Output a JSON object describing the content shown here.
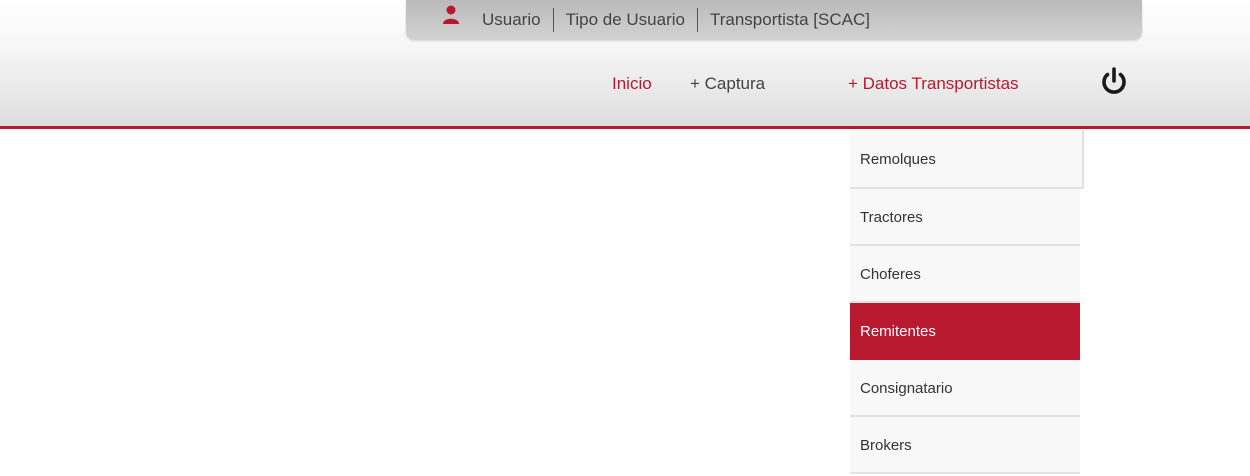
{
  "colors": {
    "accent": "#b8192f",
    "text_dark": "#444444",
    "menu_bg": "#f8f8f8",
    "userbar_bg": "#c9c9c9"
  },
  "userbar": {
    "icon": "user-icon",
    "user_label": "Usuario",
    "user_type_label": "Tipo de Usuario",
    "carrier_label": "Transportista [SCAC]"
  },
  "nav": {
    "items": [
      {
        "label": "Inicio"
      },
      {
        "label": "+ Captura"
      },
      {
        "label": "+ Datos Transportistas"
      }
    ],
    "power_icon": "power-icon"
  },
  "dropdown": {
    "items": [
      {
        "label": "Remolques"
      },
      {
        "label": "Tractores"
      },
      {
        "label": "Choferes"
      },
      {
        "label": "Remitentes",
        "active": true
      },
      {
        "label": "Consignatario"
      },
      {
        "label": "Brokers"
      }
    ]
  }
}
